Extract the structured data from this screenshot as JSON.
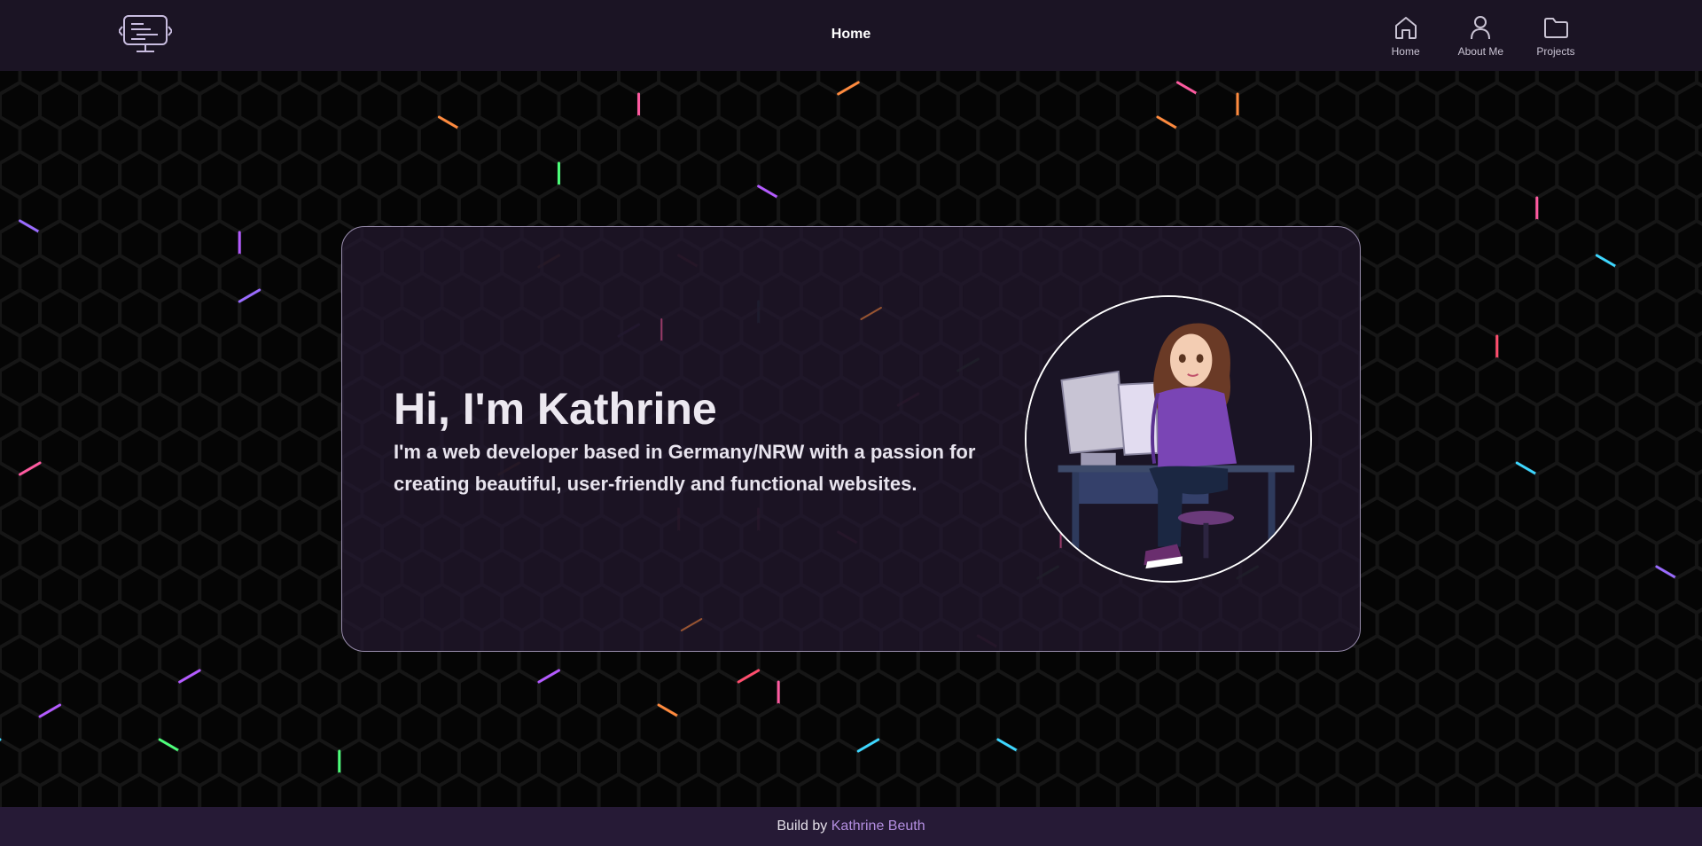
{
  "header": {
    "title": "Home",
    "nav": [
      {
        "label": "Home",
        "icon": "home-icon"
      },
      {
        "label": "About Me",
        "icon": "user-icon"
      },
      {
        "label": "Projects",
        "icon": "folder-icon"
      }
    ]
  },
  "hero": {
    "title": "Hi, I'm Kathrine",
    "subtitle": "I'm a web developer based in Germany/NRW with a passion for creating beautiful, user-friendly and functional websites."
  },
  "footer": {
    "prefix": "Build by",
    "author": "Kathrine Beuth"
  },
  "colors": {
    "header_bg": "#1b1424",
    "footer_bg": "#261a36",
    "card_bg": "#1c1424",
    "accent": "#b38ee0",
    "hex_stroke": "#161616"
  }
}
